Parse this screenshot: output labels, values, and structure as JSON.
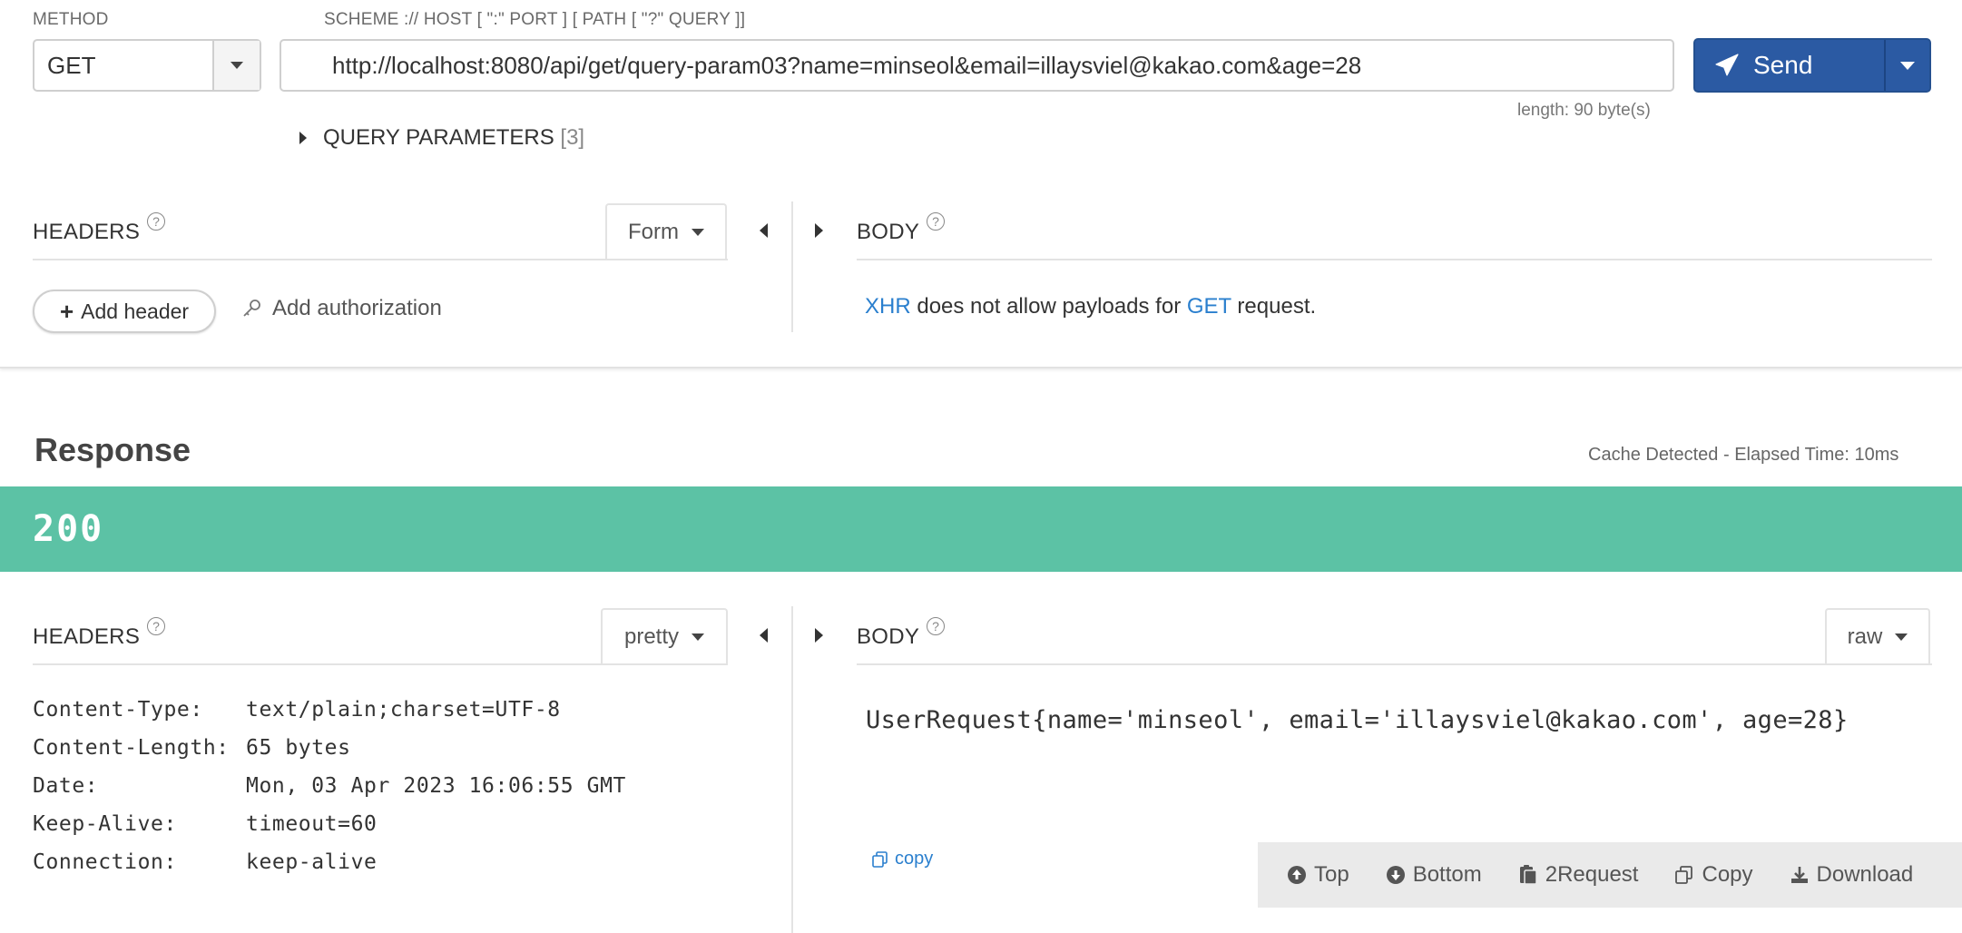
{
  "request": {
    "method_label": "METHOD",
    "method_value": "GET",
    "url_label": "SCHEME :// HOST [ \":\" PORT ] [ PATH [ \"?\" QUERY ]]",
    "url_value": "http://localhost:8080/api/get/query-param03?name=minseol&email=illaysviel@kakao.com&age=28",
    "length_info": "length: 90 byte(s)",
    "send_label": "Send",
    "query_params_label": "QUERY PARAMETERS",
    "query_params_count": "[3]",
    "headers_title": "HEADERS",
    "headers_mode": "Form",
    "add_header_label": "Add header",
    "add_authorization_label": "Add authorization",
    "body_title": "BODY",
    "body_note_xhr": "XHR",
    "body_note_mid": " does not allow payloads for ",
    "body_note_get": "GET",
    "body_note_end": " request."
  },
  "response": {
    "title": "Response",
    "cache_info": "Cache Detected -  Elapsed Time: 10ms",
    "status_code": "200",
    "status_color": "#5cc2a5",
    "headers_title": "HEADERS",
    "headers_mode": "pretty",
    "headers": [
      {
        "key": "Content-Type:",
        "value": "text/plain;charset=UTF-8"
      },
      {
        "key": "Content-Length:",
        "value": "65 bytes"
      },
      {
        "key": "Date:",
        "value": "Mon, 03 Apr 2023 16:06:55 GMT"
      },
      {
        "key": "Keep-Alive:",
        "value": "timeout=60"
      },
      {
        "key": "Connection:",
        "value": "keep-alive"
      }
    ],
    "body_title": "BODY",
    "body_mode": "raw",
    "body_text": "UserRequest{name='minseol', email='illaysviel@kakao.com', age=28}",
    "copy_label": "copy"
  },
  "toolbar": {
    "top_label": "Top",
    "bottom_label": "Bottom",
    "to_request_label": "2Request",
    "copy_label": "Copy",
    "download_label": "Download"
  },
  "colors": {
    "send_button": "#2b5aa3",
    "link": "#2a7fce"
  }
}
